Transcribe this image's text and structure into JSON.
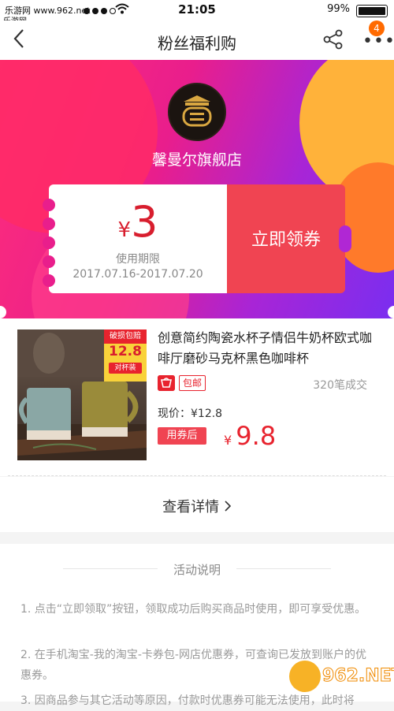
{
  "status_bar": {
    "carrier": "乐游网 www.962.net",
    "time": "21:05",
    "battery": "99%",
    "watermark_small": "乐游网"
  },
  "header": {
    "title": "粉丝福利购",
    "back_icon": "chevron-left-icon",
    "share_icon": "share-icon",
    "more_icon": "more-icon",
    "badge": "4"
  },
  "store": {
    "name": "馨曼尔旗舰店"
  },
  "coupon": {
    "currency": "¥",
    "amount": "3",
    "valid_label": "使用期限",
    "valid_dates": "2017.07.16-2017.07.20",
    "button": "立即领券"
  },
  "product": {
    "title": "创意简约陶瓷水杯子情侣牛奶杯欧式咖啡厅磨砂马克杯黑色咖啡杯",
    "image_tag_top": "破损包赔",
    "image_tag_price": "12.8",
    "image_tag_bottom": "对杯装",
    "shop_icon": "taobao-icon",
    "shipping": "包邮",
    "sold": "320笔成交",
    "now_price": "现价：¥12.8",
    "after_label": "用券后",
    "after_currency": "¥",
    "after_price": "9.8"
  },
  "detail": {
    "label": "查看详情"
  },
  "rules": {
    "heading": "活动说明",
    "items": [
      "1. 点击“立即领取”按钮，领取成功后购买商品时使用，即可享受优惠。",
      "2. 在手机淘宝-我的淘宝-卡券包-网店优惠券，可查询已发放到账户的优惠券。",
      "3. 因商品参与其它活动等原因，付款时优惠券可能无法使用，此时将"
    ]
  },
  "watermark": {
    "text": "962.NET",
    "sub": "乐游网"
  },
  "colors": {
    "accent": "#f04452",
    "price": "#e8232e",
    "hero_start": "#ff2e7a",
    "hero_end": "#7a2ef0"
  }
}
